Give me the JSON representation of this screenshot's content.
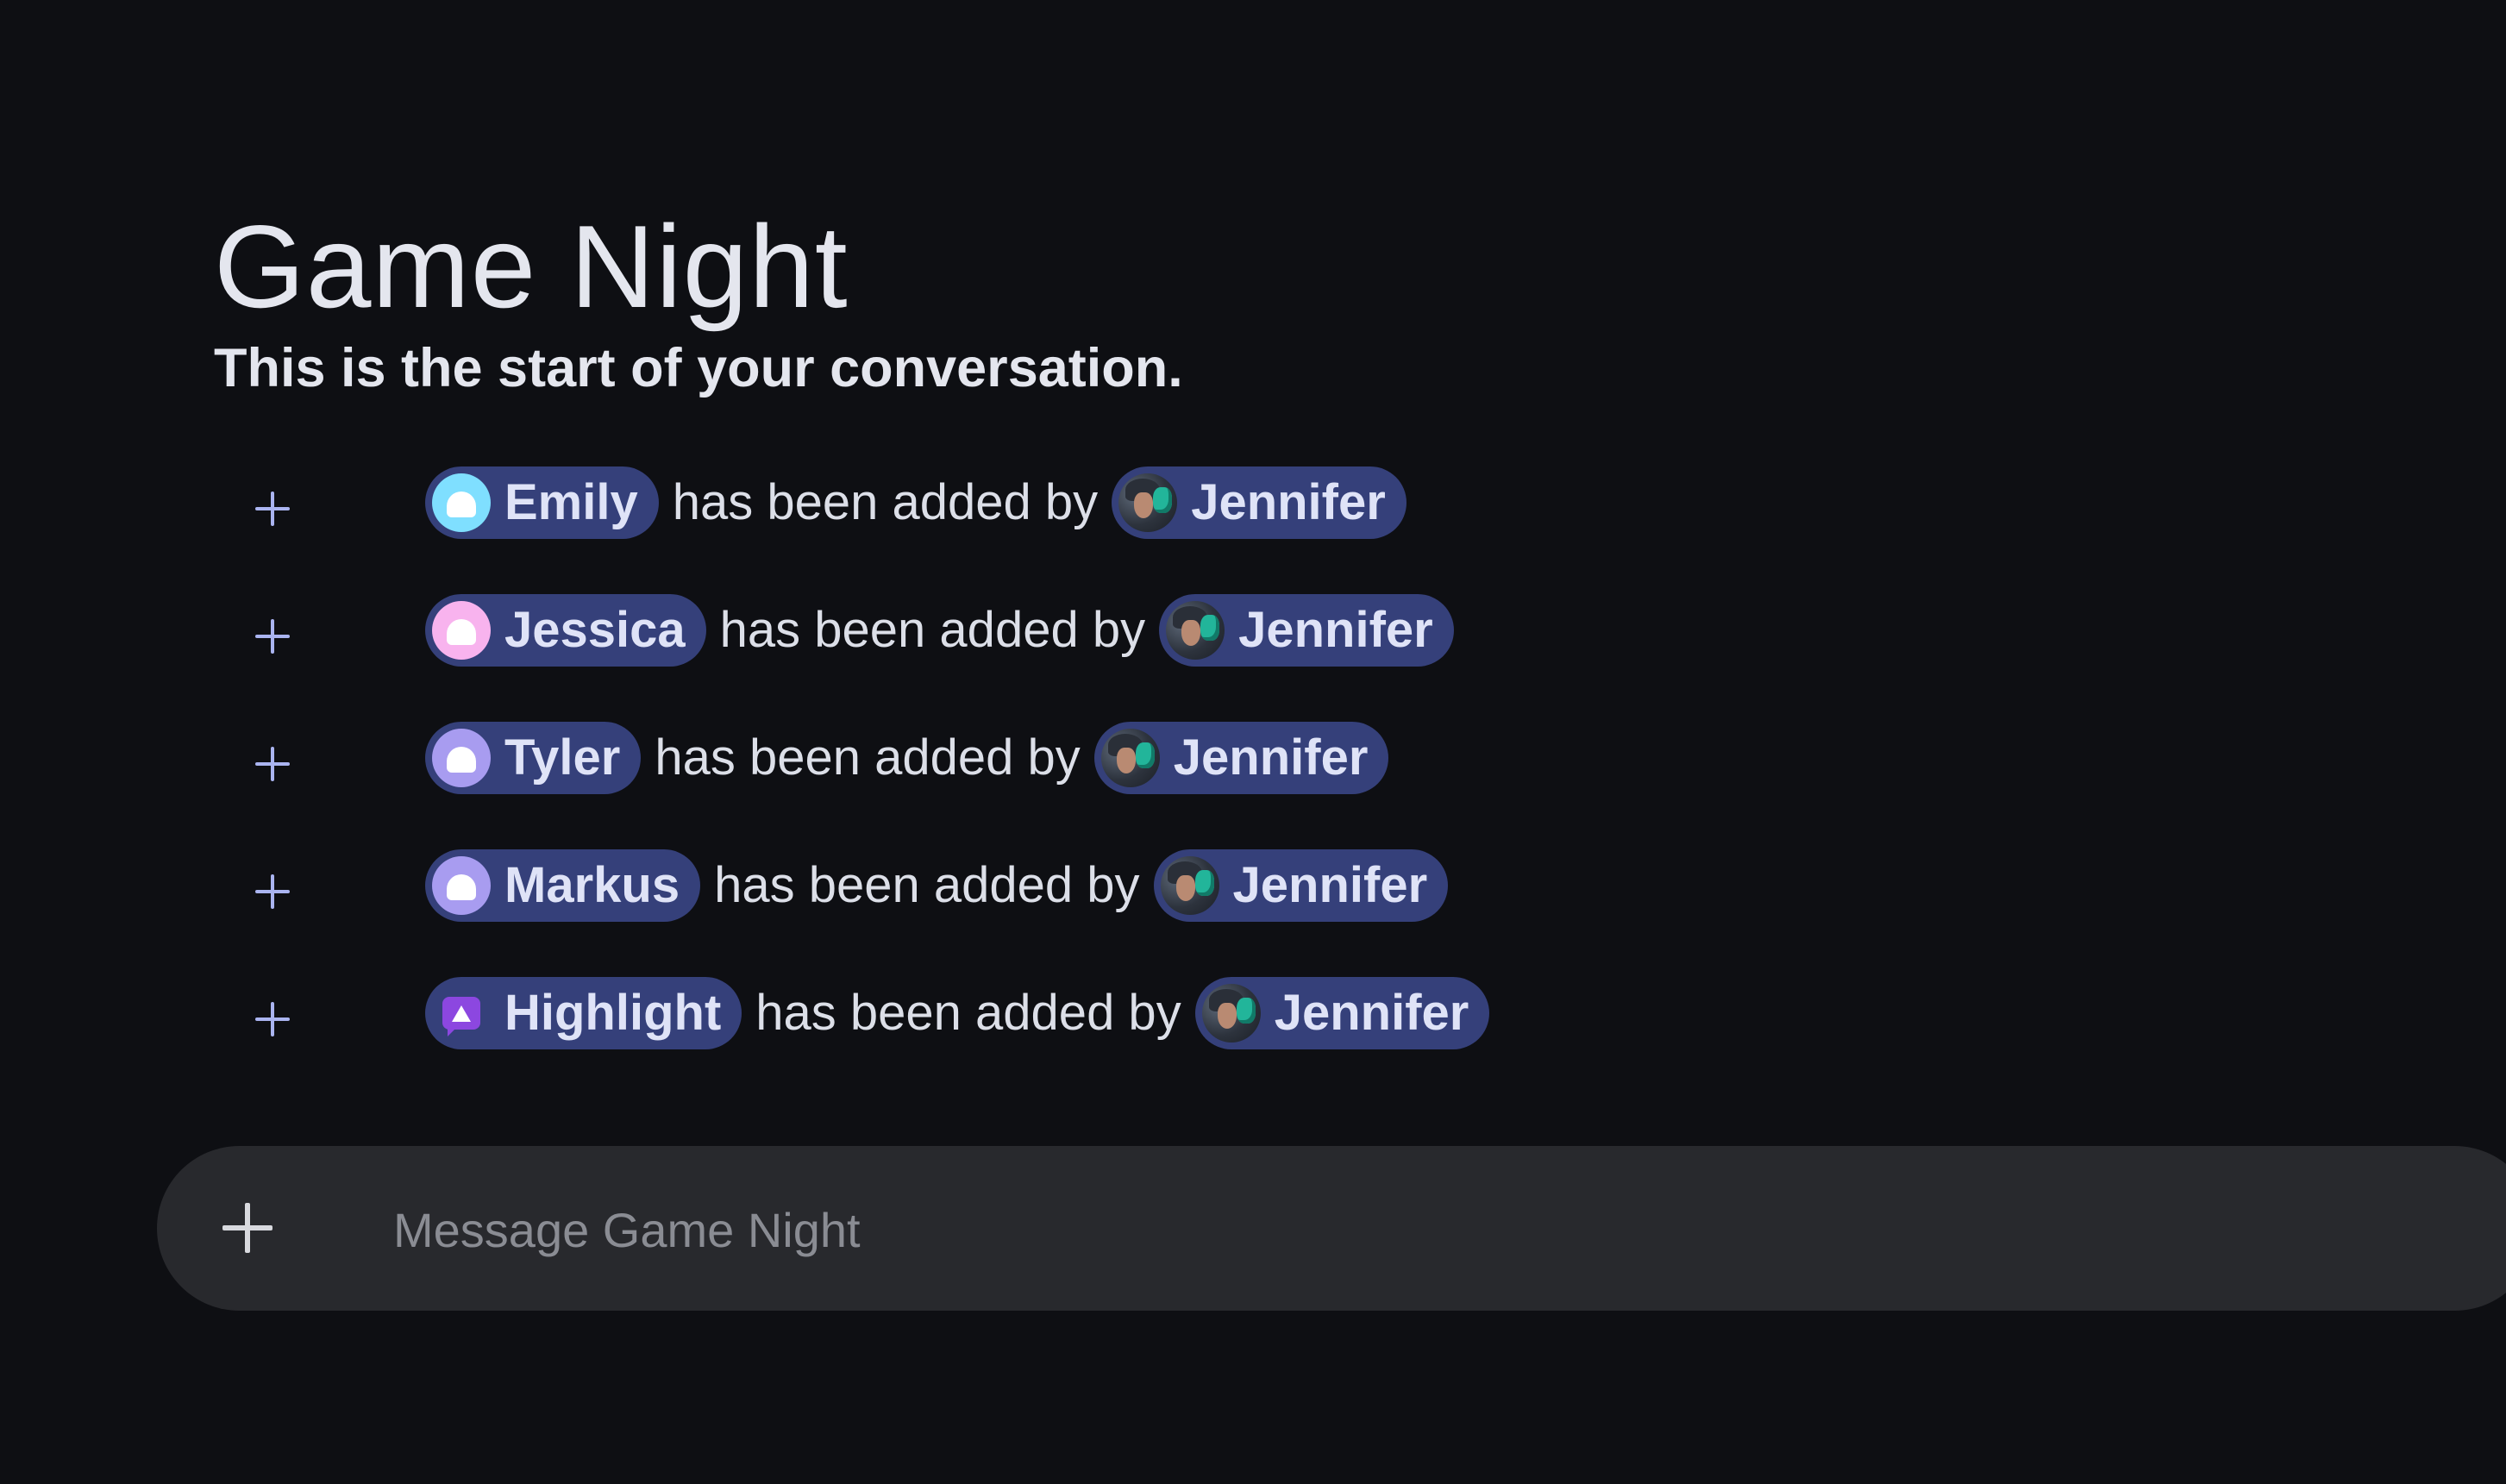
{
  "conversation": {
    "title": "Game Night",
    "subtitle": "This is the start of your conversation."
  },
  "events": [
    {
      "member": "Emily",
      "member_avatar": "bubble-avatar",
      "avatar_color": "#7fdfff",
      "action": "has been added by",
      "actor": "Jennifer"
    },
    {
      "member": "Jessica",
      "member_avatar": "bubble-avatar",
      "avatar_color": "#f8b3ee",
      "action": "has been added by",
      "actor": "Jennifer"
    },
    {
      "member": "Tyler",
      "member_avatar": "bubble-avatar",
      "avatar_color": "#a89cf0",
      "action": "has been added by",
      "actor": "Jennifer"
    },
    {
      "member": "Markus",
      "member_avatar": "bubble-avatar",
      "avatar_color": "#a89cf0",
      "action": "has been added by",
      "actor": "Jennifer"
    },
    {
      "member": "Highlight",
      "member_avatar": "warning-badge-icon",
      "avatar_color": "#8c47e0",
      "action": "has been added by",
      "actor": "Jennifer"
    }
  ],
  "composer": {
    "placeholder": "Message Game Night",
    "attach_icon": "plus-icon"
  },
  "colors": {
    "background": "#0e0f13",
    "chip": "#35407a",
    "event_icon": "#aab4f0",
    "composer_bg": "#28292d"
  }
}
